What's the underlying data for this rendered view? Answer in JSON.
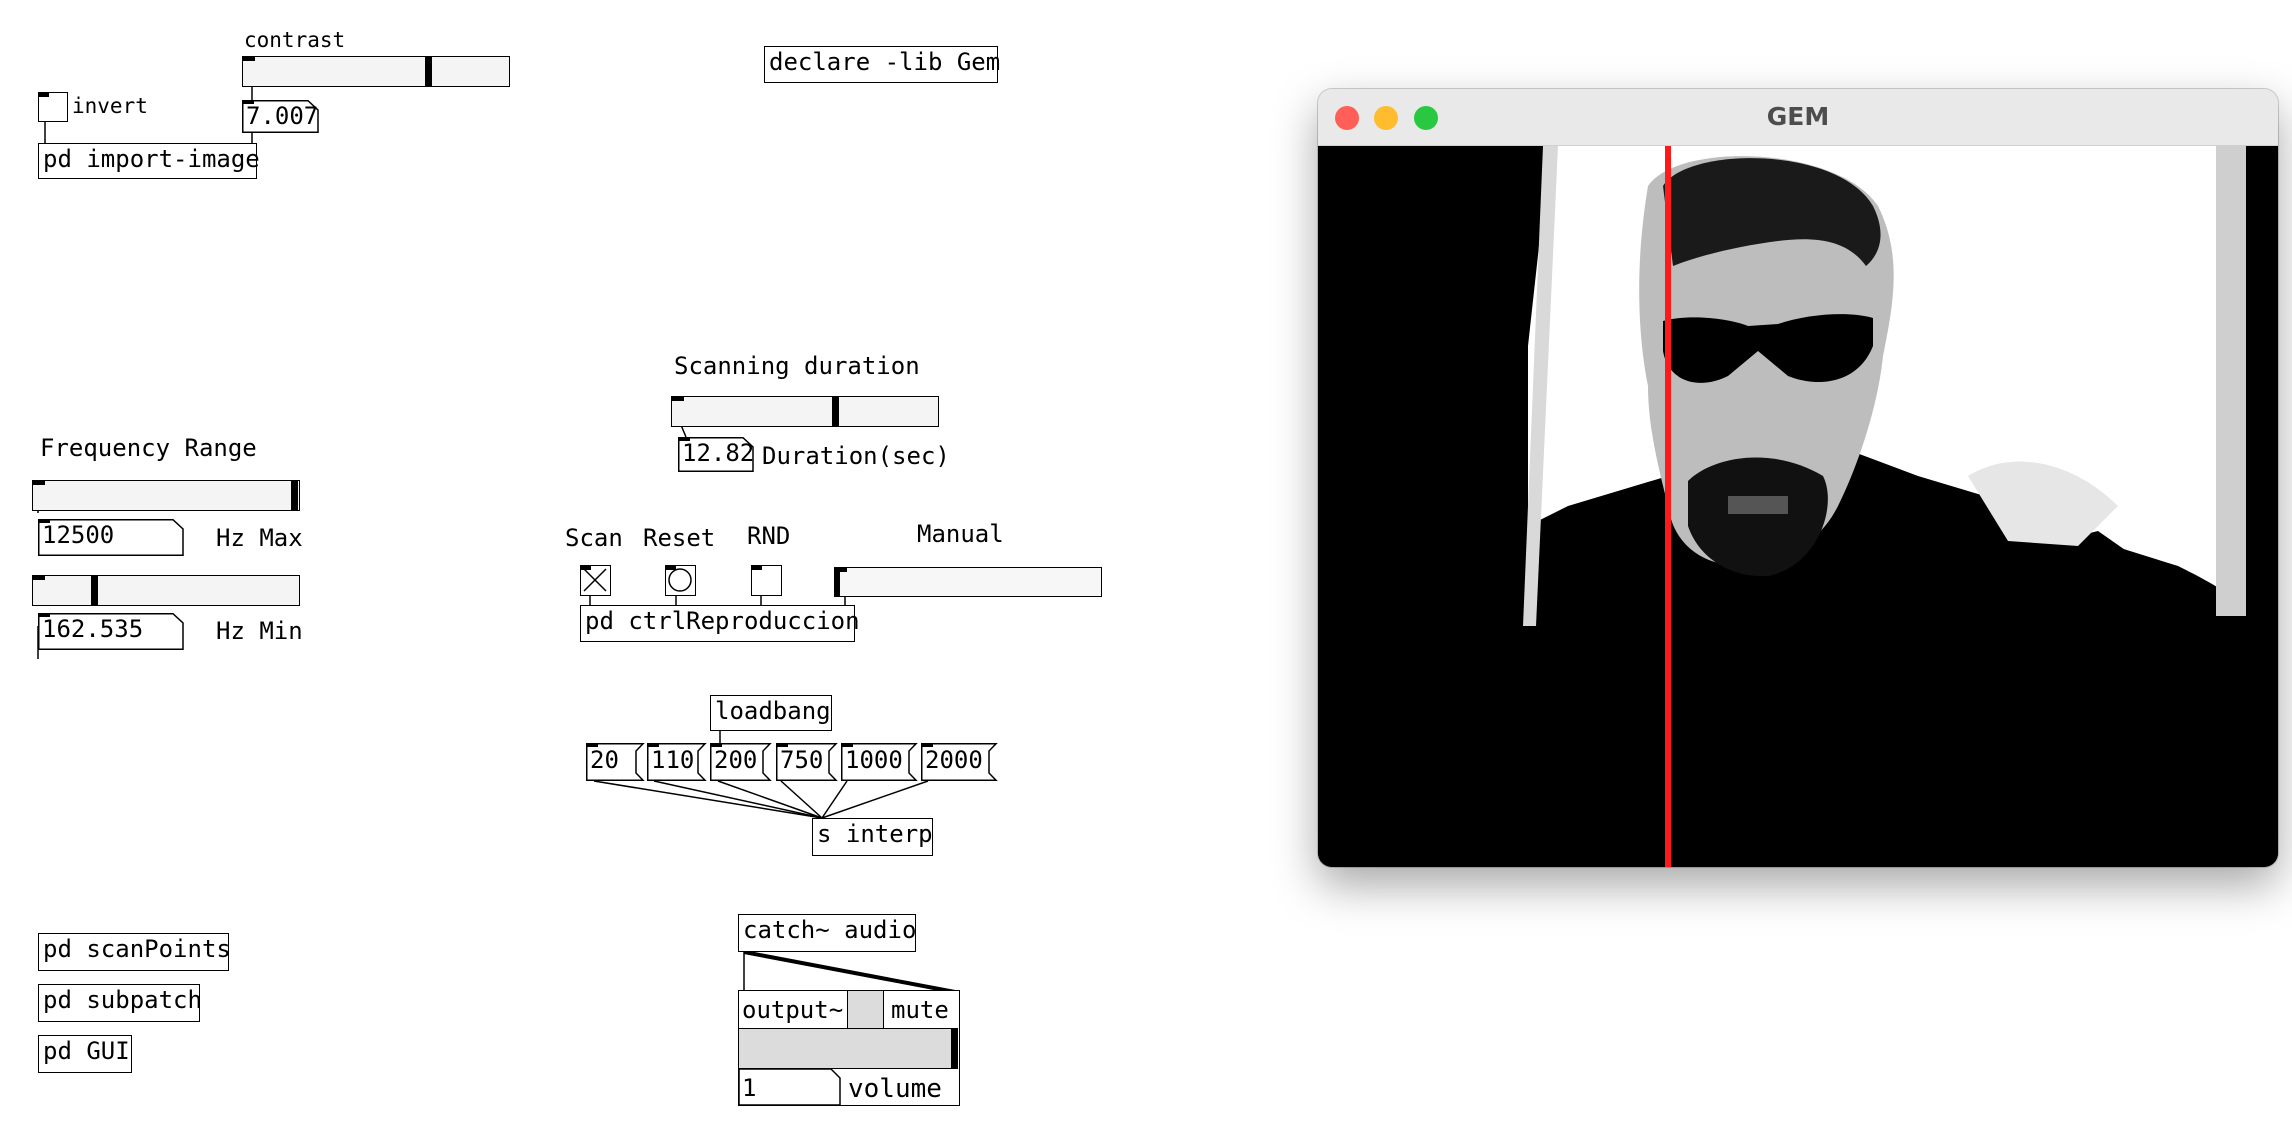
{
  "patch": {
    "contrast_label": "contrast",
    "contrast_value": "7.007",
    "invert_label": "invert",
    "import_image": "pd import-image",
    "declare": "declare -lib Gem",
    "scanning_duration_label": "Scanning duration",
    "duration_value": "12.82",
    "duration_label": "Duration(sec)",
    "frequency_range_label": "Frequency Range",
    "hz_max_value": "12500",
    "hz_max_label": "Hz Max",
    "hz_min_value": "162.535",
    "hz_min_label": "Hz Min",
    "scan_label": "Scan",
    "reset_label": "Reset",
    "rnd_label": "RND",
    "manual_label": "Manual",
    "ctrl_reproduccion": "pd ctrlReproduccion",
    "loadbang": "loadbang",
    "messages": [
      "20",
      "110",
      "200",
      "750",
      "1000",
      "2000"
    ],
    "send_interp": "s interp",
    "catch_audio": "catch~ audio",
    "output_label": "output~",
    "mute_label": "mute",
    "volume_value": "1",
    "volume_label": "volume",
    "scan_points": "pd scanPoints",
    "subpatch": "pd subpatch",
    "gui": "pd GUI",
    "contrast_slider_level": 0.68,
    "duration_slider_level": 0.61,
    "freq_max_slider_level": 0.99,
    "freq_min_slider_level": 0.22,
    "manual_slider_level": 0.0,
    "volume_slider_level": 1.0
  },
  "gem_window": {
    "title": "GEM",
    "scan_line_color": "#ff1a1a",
    "traffic_lights": [
      "#ff5f57",
      "#febc2e",
      "#28c840"
    ]
  }
}
